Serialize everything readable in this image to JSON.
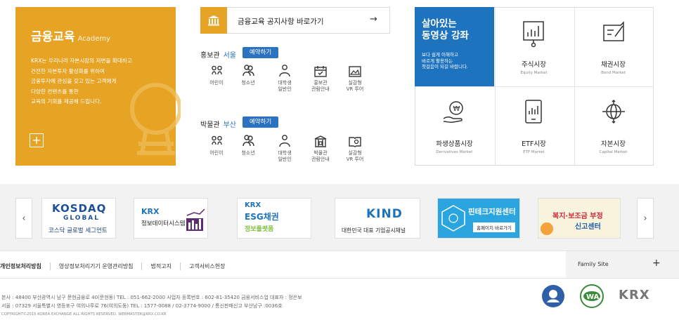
{
  "academy": {
    "title": "금융교육",
    "subtitle": "Academy",
    "text": "KRX는 우리나라 자본시장의 저변을 확대하고\n건전한 자본투자 활성화를 위하여\n금융투자에 관심을 갖고 있는 고객에게\n다양한 컨텐츠를 통한\n교육의 기회를 제공해 드립니다.",
    "plus": "+",
    "accent": "#e7a323"
  },
  "notice": {
    "label": "금융교육 공지사항 바로가기",
    "arrow": "→"
  },
  "halls": [
    {
      "name": "홍보관",
      "city": "서울",
      "reserve": "예약하기",
      "items": [
        {
          "label": "어린이",
          "icon": "children-icon"
        },
        {
          "label": "청소년",
          "icon": "teen-icon"
        },
        {
          "label": "대학생\n일반인",
          "icon": "adult-icon"
        },
        {
          "label": "홍보관\n관람안내",
          "icon": "calendar-icon"
        },
        {
          "label": "실감형\nVR 투어",
          "icon": "vr-icon"
        }
      ]
    },
    {
      "name": "박물관",
      "city": "부산",
      "reserve": "예약하기",
      "items": [
        {
          "label": "어린이",
          "icon": "children-icon"
        },
        {
          "label": "청소년",
          "icon": "teen-icon"
        },
        {
          "label": "대학생\n일반인",
          "icon": "adult-icon"
        },
        {
          "label": "박물관\n관람안내",
          "icon": "museum-icon"
        },
        {
          "label": "실감형\nVR 투어",
          "icon": "book-vr-icon"
        }
      ]
    }
  ],
  "video": {
    "title": "살아있는\n동영상 강좌",
    "desc": "보다 쉽게 이해하고\n바르게 활용하는\n첫걸음이 되길 바랍니다.",
    "color": "#1e73be"
  },
  "markets": [
    {
      "name": "주식시장",
      "sub": "Equity Market"
    },
    {
      "name": "채권시장",
      "sub": "Bond Market"
    },
    {
      "name": "파생상품시장",
      "sub": "Derivatives Market"
    },
    {
      "name": "ETF시장",
      "sub": "ETF Market"
    },
    {
      "name": "자본시장",
      "sub": "Capital Market"
    }
  ],
  "banners": [
    {
      "line1": "KOSDAQ",
      "line2": "GLOBAL",
      "line3": "코스닥 글로벌 세그먼트"
    },
    {
      "line1": "KRX",
      "line2": "정보데이터시스템"
    },
    {
      "line1": "KRX",
      "line2": "ESG채권",
      "line3": "정보플랫폼"
    },
    {
      "line1": "KIND",
      "line2": "대한민국 대표 기업공시채널"
    },
    {
      "line1": "핀테크지원센터",
      "line2": "홈페이지 바로가기"
    },
    {
      "line1": "복지·보조금 부정",
      "line2": "신고센터"
    }
  ],
  "nav": {
    "prev": "‹",
    "next": "›"
  },
  "footer": {
    "links": [
      "개인정보처리방침",
      "영상정보처리기기 운영관리방침",
      "법적고지",
      "고객서비스헌장"
    ],
    "family": "Family Site",
    "family_plus": "+",
    "address": "본사 : 48400 부산광역시 남구 문현금융로 40(문현동) TEL : 051-662-2000 사업자 등록번호 : 602-81-35420 금융서비스업 대표자 : 정은보\n서울 : 07329 서울특별시 영등포구 여의나루로 76(여의도동) TEL : 1577-0088 / 02-3774-9000 / 통신판매신고 부산남구 :0036호",
    "copyright": "COPYRIGHT©2015 KOREA EXCHANGE ALL RIGHTS RESERVED. WEBMASTER@KRX.CO.KR",
    "krx_logo": "KRX"
  }
}
